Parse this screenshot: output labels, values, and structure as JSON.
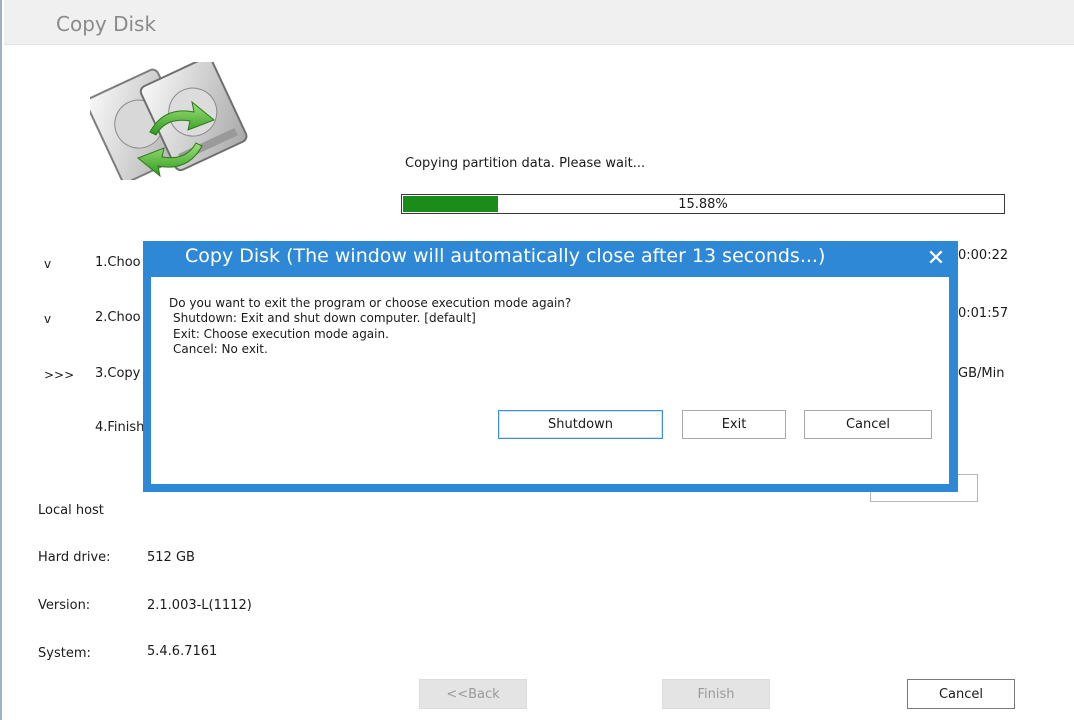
{
  "window": {
    "title": "Copy Disk"
  },
  "status": {
    "message": "Copying partition data. Please wait...",
    "progress_label": "15.88%",
    "progress_fraction": 0.1588,
    "progress_color": "#1a8c1a"
  },
  "steps": [
    {
      "marker": "v",
      "label": "1.Choo",
      "value": "0:00:22"
    },
    {
      "marker": "v",
      "label": "2.Choo",
      "value": "0:01:57"
    },
    {
      "marker": ">>>",
      "label": "3.Copy",
      "value": "GB/Min"
    },
    {
      "marker": "",
      "label": "4.Finish",
      "value": ""
    }
  ],
  "info": {
    "host_label": "Local host",
    "drive_label": "Hard drive:",
    "drive_value": "512 GB",
    "version_label": "Version:",
    "version_value": "2.1.003-L(1112)",
    "system_label": "System:",
    "system_value": "5.4.6.7161"
  },
  "bottom_buttons": {
    "back": "<<Back",
    "finish": "Finish",
    "cancel": "Cancel"
  },
  "dialog": {
    "title": "Copy Disk (The window will automatically close after 13 seconds...)",
    "close_glyph": "✕",
    "lines": [
      "Do you want to exit the program or choose execution mode again?",
      "Shutdown: Exit and shut down computer. [default]",
      "Exit: Choose execution mode again.",
      "Cancel: No exit."
    ],
    "buttons": {
      "shutdown": "Shutdown",
      "exit": "Exit",
      "cancel": "Cancel"
    },
    "accent_color": "#2e88d6"
  },
  "icons": {
    "disk": "copy-disk-icon",
    "close": "close-icon"
  }
}
